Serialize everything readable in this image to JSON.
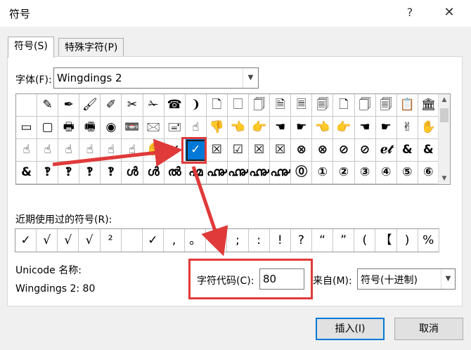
{
  "dialog": {
    "title": "符号",
    "help_glyph": "?",
    "close_glyph": "✕"
  },
  "tabs": [
    {
      "label": "符号(S)"
    },
    {
      "label": "特殊字符(P)"
    }
  ],
  "font": {
    "label": "字体(F):",
    "value": "Wingdings 2"
  },
  "symbol_grid": {
    "rows": [
      [
        " ",
        "✎",
        "✒",
        "🖌",
        "✐",
        "✂",
        "✁",
        "☎",
        "❩",
        "🗋",
        "🗌",
        "🗍",
        "🗎",
        "🗏",
        "🗐",
        "🗋",
        "🗍",
        "🗐",
        "📋",
        "🏛"
      ],
      [
        "▭",
        "▢",
        "🖶",
        "🖷",
        "◉",
        "📼",
        "🖂",
        "🖃",
        "☝",
        "👎",
        "👈",
        "👉",
        "☚",
        "☛",
        "👈",
        "👉",
        "☚",
        "☛",
        "✌",
        "✋"
      ],
      [
        "☝",
        "☝",
        "☝",
        "☝",
        "☝",
        "☝",
        "✋",
        "✕",
        "✓",
        "☒",
        "☑",
        "☒",
        "☒",
        "⊗",
        "⊗",
        "⊘",
        "⊘",
        "ℯ𝓉",
        "&",
        "&"
      ],
      [
        "&",
        "‽",
        "‽",
        "‽",
        "‽",
        "ൾ",
        "ൾ",
        "ൽ",
        "൶",
        "൷",
        "൷",
        "൷",
        "൷",
        "⓪",
        "①",
        "②",
        "③",
        "④",
        "⑤",
        "⑥"
      ]
    ],
    "selected_symbol": "✓"
  },
  "recent": {
    "label": "近期使用过的符号(R):",
    "symbols": [
      "✓",
      "√",
      "√",
      "√",
      "²",
      "",
      "✓",
      ",",
      "。",
      "",
      ";",
      ":",
      "!",
      "?",
      "“",
      "”",
      "(",
      "【",
      ")",
      "%"
    ]
  },
  "unicode_name": {
    "label": "Unicode 名称:",
    "value": "Wingdings 2: 80"
  },
  "char_code": {
    "label": "字符代码(C):",
    "value": "80"
  },
  "from": {
    "label": "来自(M):",
    "value": "符号(十进制)"
  },
  "buttons": {
    "insert": "插入(I)",
    "cancel": "取消"
  },
  "annotation_color": "#e03a3a"
}
